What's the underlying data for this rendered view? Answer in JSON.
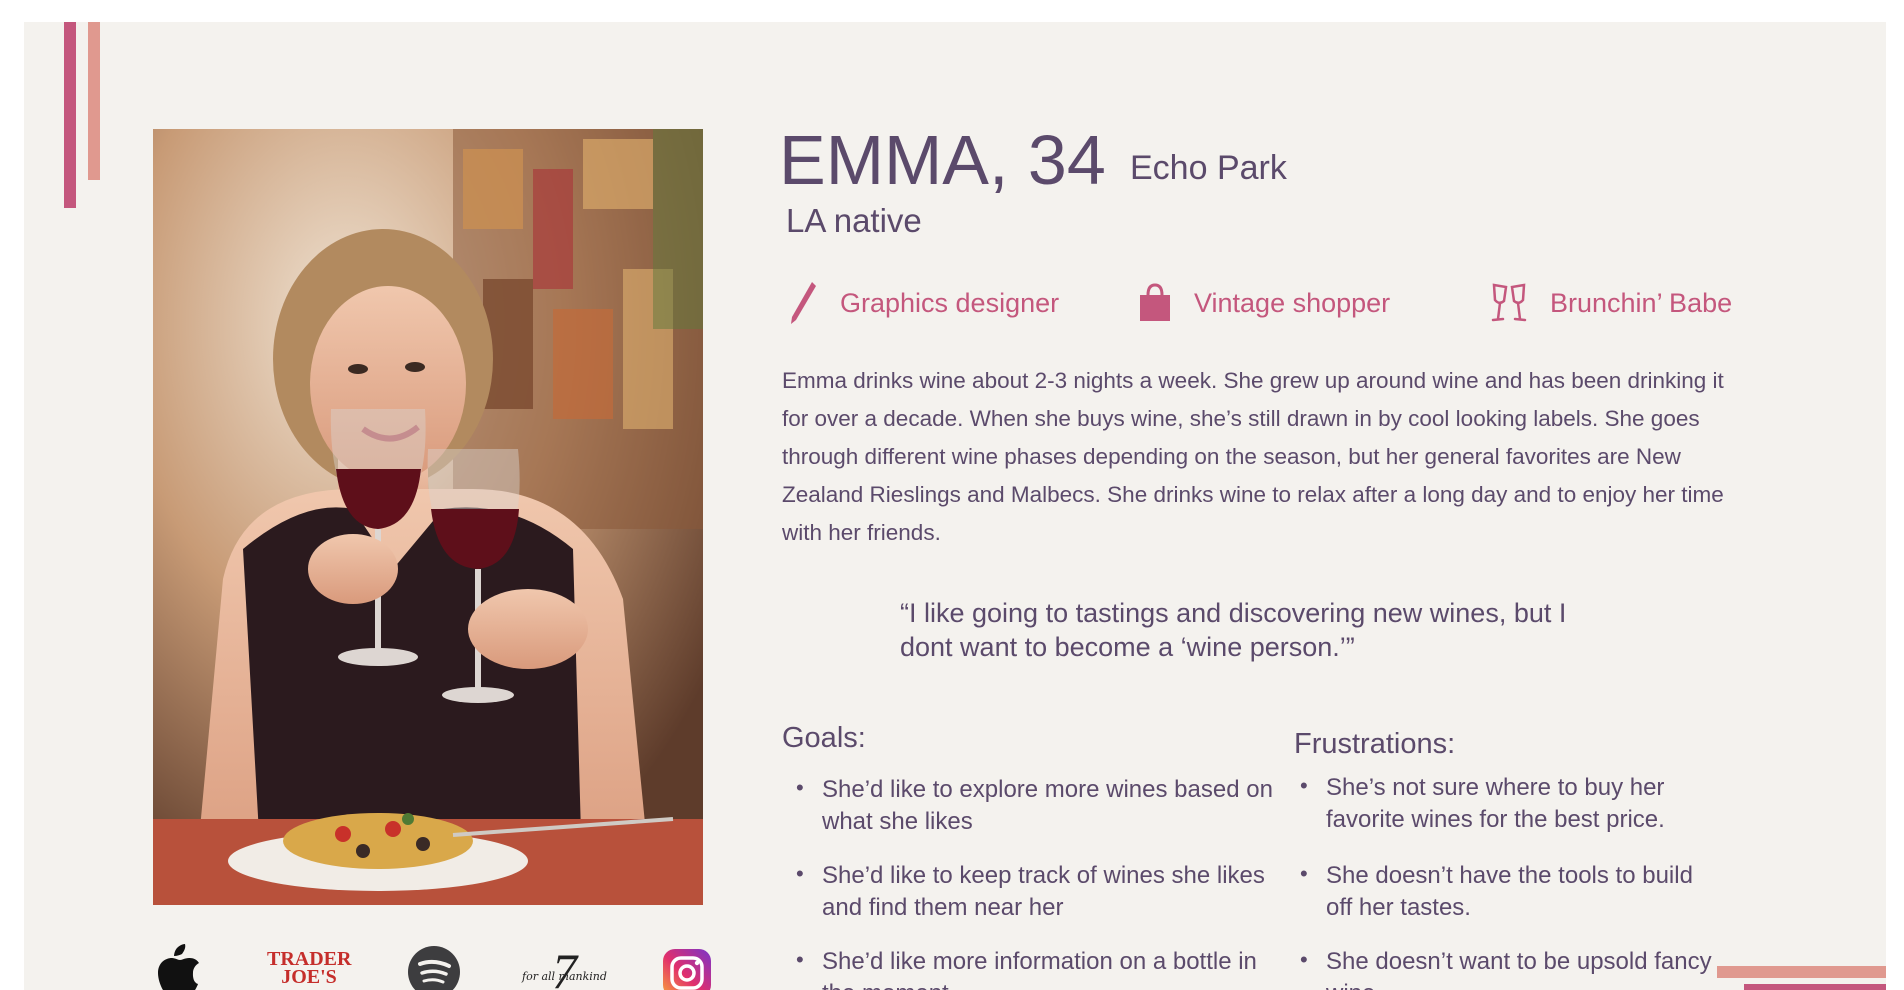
{
  "persona": {
    "name": "EMMA, 34",
    "location": "Echo Park",
    "origin": "LA native"
  },
  "traits": [
    {
      "icon": "pencil-icon",
      "label": "Graphics designer"
    },
    {
      "icon": "shopping-bag-icon",
      "label": "Vintage shopper"
    },
    {
      "icon": "champagne-glasses-icon",
      "label": "Brunchin’ Babe"
    }
  ],
  "bio": "Emma drinks wine about 2-3 nights a week. She grew up around wine and has been drinking it for over a decade. When she buys wine, she’s still drawn in by cool looking labels. She goes through different wine phases depending on the season, but her general favorites are New Zealand Rieslings and Malbecs. She drinks wine to relax after a long day and to enjoy her time with her friends.",
  "quote": "“I like going to tastings and discovering new wines, but I dont want to become a ‘wine person.’”",
  "goals": {
    "heading": "Goals:",
    "items": [
      "She’d like to explore more wines based on what she likes",
      "She’d like to keep track of wines she likes and find them near her",
      "She’d like more information on a bottle in the moment"
    ]
  },
  "frustrations": {
    "heading": "Frustrations:",
    "items": [
      "She’s not sure where to buy her favorite wines for the best price.",
      "She doesn’t have the tools to build off her tastes.",
      "She doesn’t want to be upsold fancy wine"
    ]
  },
  "logos": {
    "apple": "apple-logo",
    "trader_joes": "TRADER JOE'S",
    "spotify": "spotify-logo",
    "seven_for_all_mankind": "for all mankind",
    "instagram": "instagram-logo"
  },
  "colors": {
    "text": "#5b4a6b",
    "accent": "#c4577d",
    "accent_light": "#e0998f",
    "background": "#f4f2ee"
  }
}
